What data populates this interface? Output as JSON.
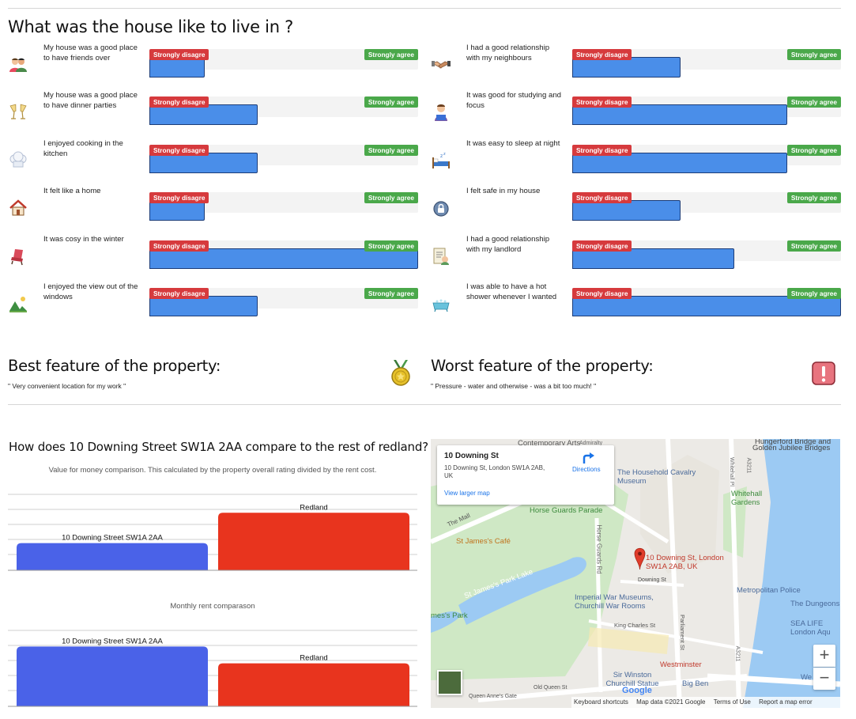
{
  "live_section": {
    "title": "What was the house like to live in ?",
    "disagree_label": "Strongly disagre",
    "agree_label": "Strongly agree",
    "left": [
      {
        "label": "My house was a good place to have friends over",
        "icon": "friends-icon",
        "score": 0.2
      },
      {
        "label": "My house was a good place to have dinner parties",
        "icon": "cheers-glasses-icon",
        "score": 0.4
      },
      {
        "label": "I enjoyed cooking in the kitchen",
        "icon": "chef-hat-icon",
        "score": 0.4
      },
      {
        "label": "It felt like a home",
        "icon": "house-icon",
        "score": 0.2
      },
      {
        "label": "It was cosy in the winter",
        "icon": "armchair-icon",
        "score": 1.0
      },
      {
        "label": "I enjoyed the view out of the windows",
        "icon": "landscape-icon",
        "score": 0.4
      }
    ],
    "right": [
      {
        "label": "I had a good relationship with my neighbours",
        "icon": "handshake-icon",
        "score": 0.4
      },
      {
        "label": "It was good for studying and focus",
        "icon": "student-reading-icon",
        "score": 0.8
      },
      {
        "label": "It was easy to sleep at night",
        "icon": "bed-sleep-icon",
        "score": 0.8
      },
      {
        "label": "I felt safe in my house",
        "icon": "safe-lock-icon",
        "score": 0.4
      },
      {
        "label": "I had a good relationship with my landlord",
        "icon": "landlord-document-icon",
        "score": 0.6
      },
      {
        "label": "I was able to have a hot shower whenever I wanted",
        "icon": "bathtub-icon",
        "score": 1.0
      }
    ]
  },
  "best_feature": {
    "title": "Best feature of the property:",
    "text": "\" Very convenient location for my work \"",
    "icon": "medal-icon"
  },
  "worst_feature": {
    "title": "Worst feature of the property:",
    "text": "\" Pressure - water and otherwise - was a bit too much! \"",
    "icon": "warning-exclamation-icon"
  },
  "comparison": {
    "title": "How does 10 Downing Street SW1A 2AA compare to the rest of redland?",
    "value_note": "Value for money comparison. This calculated by the property overall rating divided by the rent cost.",
    "rent_note": "Monthly rent comparason"
  },
  "chart_data": [
    {
      "type": "bar",
      "title": "",
      "categories": [
        "10 Downing Street SW1A 2AA",
        "Redland"
      ],
      "values": [
        1.7,
        3.6
      ],
      "ylim": [
        0,
        5
      ],
      "colors": [
        "#4a62e8",
        "#e8341e"
      ],
      "grid": true
    },
    {
      "type": "bar",
      "title": "",
      "categories": [
        "10 Downing Street SW1A 2AA",
        "Redland"
      ],
      "values": [
        3.9,
        2.8
      ],
      "ylim": [
        0,
        5
      ],
      "colors": [
        "#4a62e8",
        "#e8341e"
      ],
      "grid": true
    }
  ],
  "map": {
    "place_name": "10 Downing St",
    "address": "10 Downing St, London SW1A 2AB, UK",
    "directions_label": "Directions",
    "larger_map_label": "View larger map",
    "pin_label": "10 Downing St, London SW1A 2AB, UK",
    "labels": {
      "household": "The Household Cavalry Museum",
      "horse_guards_parade": "Horse Guards Parade",
      "whitehall_gardens": "Whitehall Gardens",
      "the_mall": "The Mall",
      "st_james_cafe": "St James's Café",
      "st_james_lake": "St James's Park Lake",
      "st_james_park": "mes's Park",
      "horse_guards_rd": "Horse Guards Rd",
      "downing_st": "Downing St",
      "iwm": "Imperial War Museums, Churchill War Rooms",
      "metropolitan_police": "Metropolitan Police",
      "the_dungeons": "The Dungeons",
      "sea_life": "SEA LIFE London Aqu",
      "king_charles_st": "King Charles St",
      "parliament_st": "Parliament St",
      "westminster": "Westminster",
      "churchill_statue": "Sir Winston Churchill Statue",
      "big_ben": "Big Ben",
      "old_queen_st": "Old Queen St",
      "queen_annes_gate": "Queen Anne's Gate",
      "whitehall_pl": "Whitehall Pl",
      "a3211_top": "A3211",
      "a3212": "A3211",
      "jubilee_bridges": "Golden Jubilee Bridges",
      "hungerford": "Hungerford Bridge and",
      "contemporary": "Contemporary Arts",
      "we": "We",
      "admiralty": "Admiralty"
    },
    "footer": {
      "google": "Google",
      "shortcuts": "Keyboard shortcuts",
      "map_data": "Map data ©2021 Google",
      "terms": "Terms of Use",
      "report": "Report a map error"
    },
    "zoom_in": "+",
    "zoom_out": "−"
  }
}
